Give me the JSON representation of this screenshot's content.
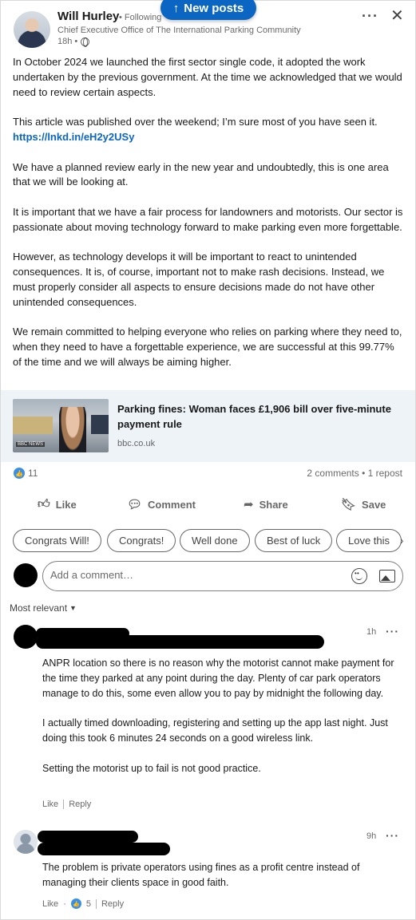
{
  "new_posts": {
    "label": "New posts",
    "icon": "arrow-up-icon"
  },
  "author": {
    "name": "Will Hurley",
    "follow_status": "• Following",
    "headline": "Chief Executive Office of The International Parking Community",
    "time": "18h •"
  },
  "post": {
    "paragraphs": [
      "In October 2024 we launched the first sector single code, it adopted the work undertaken by the previous government. At the time we acknowledged that we would need to review certain aspects.",
      "We have a planned review early in the new year and undoubtedly, this is one area that we will be looking at.",
      "It is important that we have a fair process for landowners and motorists. Our sector is passionate about moving technology forward to make parking even more forgettable.",
      "However, as technology develops it will be important to react to unintended consequences. It is, of course, important not to make rash decisions. Instead, we must properly consider all aspects to ensure decisions made do not have other unintended consequences.",
      "We remain committed to helping everyone who relies on parking where they need to, when they need to have a forgettable experience, we are successful at this 99.77% of the time and we will always be aiming higher."
    ],
    "article_line": "This article was published over the weekend; I’m sure most of you have seen it.",
    "link": "https://lnkd.in/eH2y2USy"
  },
  "article": {
    "title": "Parking fines: Woman faces £1,906 bill over five-minute payment rule",
    "source": "bbc.co.uk",
    "thumb_badge": "BBC NEWS"
  },
  "social": {
    "reaction_count": "11",
    "counts": "2 comments • 1 repost"
  },
  "actions": {
    "like": "Like",
    "comment": "Comment",
    "share": "Share",
    "save": "Save"
  },
  "chips": [
    "Congrats Will!",
    "Congrats!",
    "Well done",
    "Best of luck",
    "Love this"
  ],
  "comment_box": {
    "placeholder": "Add a comment…"
  },
  "sort": {
    "label": "Most relevant"
  },
  "comments": [
    {
      "time": "1h",
      "paragraphs": [
        "ANPR location so there is no reason why the motorist cannot make payment for the time they parked at any point during the day. Plenty of car park operators manage to do this, some even allow you to pay by midnight the following day.",
        "I actually timed downloading, registering and setting up the app last night. Just doing this took 6 minutes 24 seconds on a good wireless link.",
        "Setting the motorist up to fail is not good practice."
      ],
      "like_label": "Like",
      "reply_label": "Reply"
    },
    {
      "time": "9h",
      "paragraphs": [
        "The problem is private operators using fines as a profit centre instead of managing their clients space in good faith."
      ],
      "like_label": "Like",
      "like_count": "5",
      "reply_label": "Reply"
    }
  ],
  "colors": {
    "accent": "#0a66c2",
    "article_bg": "#eef3f8",
    "like_blue": "#378fe9"
  }
}
